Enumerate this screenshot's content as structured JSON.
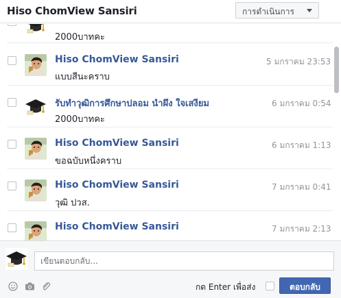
{
  "header": {
    "title": "Hiso ChomView Sansiri",
    "actions_label": "การดำเนินการ"
  },
  "messages": [
    {
      "sender": "",
      "text": "2000บาทคะ",
      "timestamp": "",
      "avatar": "graduation-cap-icon"
    },
    {
      "sender": "Hiso ChomView Sansiri",
      "text": "แบบสีนะคราบ",
      "timestamp": "5 มกราคม 23:53",
      "avatar": "profile-photo"
    },
    {
      "sender": "รับทำวุฒิการศึกษาปลอม นำผึง ใจเสงียม",
      "text": "2000บาทคะ",
      "timestamp": "6 มกราคม 0:54",
      "avatar": "graduation-cap-icon"
    },
    {
      "sender": "Hiso ChomView Sansiri",
      "text": "ขอฉบับหนึ่งคราบ",
      "timestamp": "6 มกราคม 1:13",
      "avatar": "profile-photo"
    },
    {
      "sender": "Hiso ChomView Sansiri",
      "text": "วุฒิ ปวส.",
      "timestamp": "7 มกราคม 0:41",
      "avatar": "profile-photo"
    },
    {
      "sender": "Hiso ChomView Sansiri",
      "text": "",
      "timestamp": "7 มกราคม 2:13",
      "avatar": "profile-photo"
    }
  ],
  "composer": {
    "placeholder": "เขียนตอบกลับ...",
    "enter_to_send_label": "กด Enter เพื่อส่ง",
    "reply_button_label": "ตอบกลับ"
  },
  "colors": {
    "sender_link": "#365899",
    "reply_button": "#4267b2",
    "timestamp": "#90949c"
  }
}
